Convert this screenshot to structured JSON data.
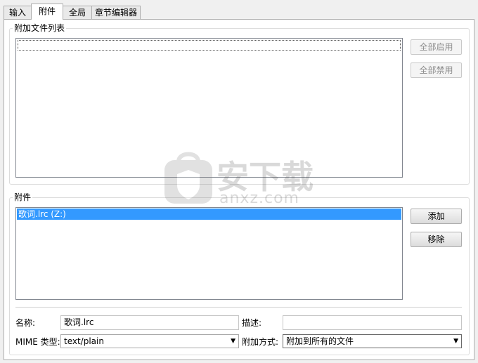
{
  "tabs": [
    "输入",
    "附件",
    "全局",
    "章节编辑器"
  ],
  "attach_list_section": {
    "title": "附加文件列表",
    "enable_all": "全部启用",
    "disable_all": "全部禁用"
  },
  "attachments_section": {
    "title": "附件",
    "items": [
      "歌词.lrc (Z:)"
    ],
    "add": "添加",
    "remove": "移除"
  },
  "fields": {
    "name_label": "名称:",
    "name_value": "歌词.lrc",
    "description_label": "描述:",
    "description_value": "",
    "mime_label": "MIME 类型:",
    "mime_value": "text/plain",
    "attach_mode_label": "附加方式:",
    "attach_mode_value": "附加到所有的文件"
  },
  "watermark": {
    "text": "安下载",
    "subtext": "anxz.com"
  },
  "colors": {
    "selection": "#3399ff",
    "panel": "#ffffff",
    "window": "#f0f0f0"
  }
}
